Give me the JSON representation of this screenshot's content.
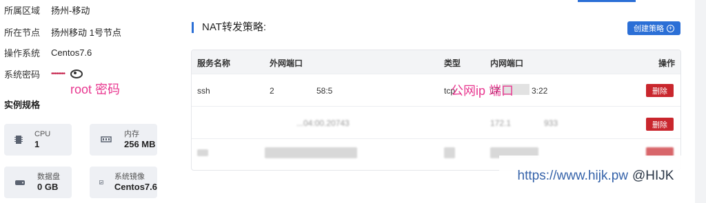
{
  "info": {
    "region_label": "所属区域",
    "region_value": "扬州-移动",
    "node_label": "所在节点",
    "node_value": "扬州移动 1号节点",
    "os_label": "操作系统",
    "os_value": "Centos7.6",
    "pwd_label": "系统密码",
    "pwd_mask": "••••••••"
  },
  "annotations": {
    "root_pwd": "root 密码",
    "public_ip_port": "公网ip   端口"
  },
  "specs": {
    "title": "实例规格",
    "items": [
      {
        "label": "CPU",
        "value": "1",
        "icon": "cpu-icon"
      },
      {
        "label": "内存",
        "value": "256 MB",
        "icon": "memory-icon"
      },
      {
        "label": "数据盘",
        "value": "0 GB",
        "icon": "disk-icon"
      },
      {
        "label": "系统镜像",
        "value": "Centos7.6",
        "icon": "image-icon"
      }
    ]
  },
  "nat": {
    "title": "NAT转发策略:",
    "create_label": "创建策略",
    "columns": [
      "服务名称",
      "外网端口",
      "类型",
      "内网端口",
      "操作"
    ],
    "rows": [
      {
        "name": "ssh",
        "ext_prefix": "2",
        "ext_suffix": "58:5",
        "type": "tcp",
        "int_prefix": "17",
        "int_suffix": "3:22",
        "action": "删除"
      },
      {
        "name": "",
        "ext_suffix": "...04:00.20743",
        "type": "",
        "int_prefix": "172.1",
        "int_suffix": "933",
        "action": "删除"
      },
      {
        "name": "",
        "type": "",
        "action": ""
      }
    ]
  },
  "watermark": {
    "url": "https://www.hijk.pw",
    "handle": "@HIJK"
  }
}
